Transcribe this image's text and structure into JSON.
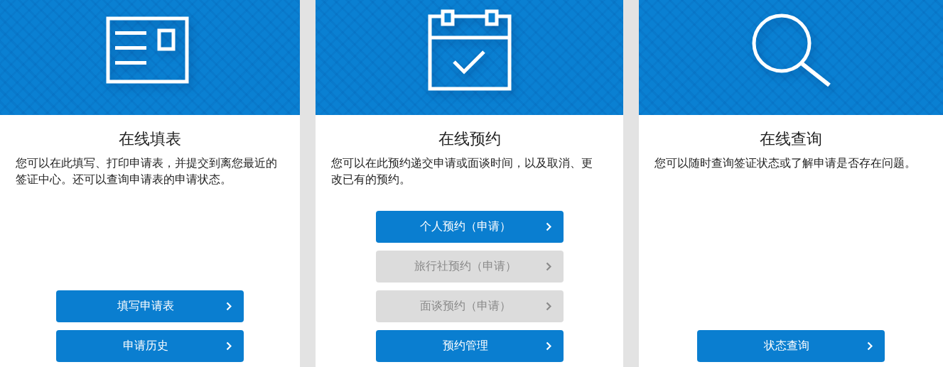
{
  "cards": [
    {
      "kind": "form",
      "title": "在线填表",
      "description": "您可以在此填写、打印申请表，并提交到离您最近的签证中心。还可以查询申请表的申请状态。",
      "buttons": [
        {
          "label": "填写申请表",
          "disabled": false
        },
        {
          "label": "申请历史",
          "disabled": false
        }
      ]
    },
    {
      "kind": "calendar",
      "title": "在线预约",
      "description": "您可以在此预约递交申请或面谈时间，以及取消、更改已有的预约。",
      "buttons": [
        {
          "label": "个人预约（申请）",
          "disabled": false
        },
        {
          "label": "旅行社预约（申请）",
          "disabled": true
        },
        {
          "label": "面谈预约（申请）",
          "disabled": true
        },
        {
          "label": "预约管理",
          "disabled": false
        }
      ]
    },
    {
      "kind": "search",
      "title": "在线查询",
      "description": "您可以随时查询签证状态或了解申请是否存在问题。",
      "buttons": [
        {
          "label": "状态查询",
          "disabled": false
        }
      ]
    }
  ]
}
